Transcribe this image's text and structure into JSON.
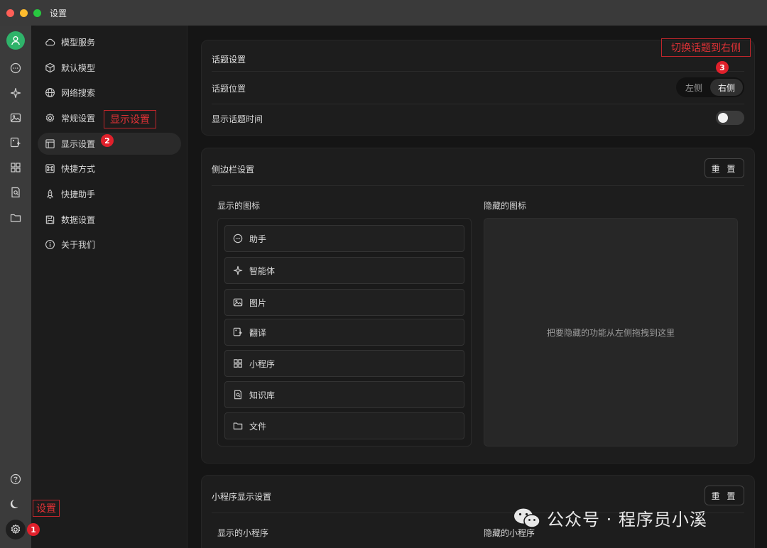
{
  "window": {
    "title": "设置"
  },
  "icon_rail": {
    "items": [
      {
        "icon": "chat-bubble-icon"
      },
      {
        "icon": "sparkle-icon"
      },
      {
        "icon": "image-icon"
      },
      {
        "icon": "translate-icon"
      },
      {
        "icon": "grid-icon"
      },
      {
        "icon": "knowledge-doc-icon"
      },
      {
        "icon": "folder-icon"
      }
    ],
    "bottom": [
      {
        "icon": "help-circle-icon"
      },
      {
        "icon": "moon-icon"
      },
      {
        "icon": "gear-icon"
      }
    ]
  },
  "nav": {
    "items": [
      {
        "label": "模型服务",
        "icon": "cloud-icon"
      },
      {
        "label": "默认模型",
        "icon": "cube-icon"
      },
      {
        "label": "网络搜索",
        "icon": "globe-icon"
      },
      {
        "label": "常规设置",
        "icon": "gear-icon"
      },
      {
        "label": "显示设置",
        "icon": "layout-icon",
        "active": true
      },
      {
        "label": "快捷方式",
        "icon": "command-icon"
      },
      {
        "label": "快捷助手",
        "icon": "rocket-icon"
      },
      {
        "label": "数据设置",
        "icon": "save-icon"
      },
      {
        "label": "关于我们",
        "icon": "info-icon"
      }
    ]
  },
  "topic_card": {
    "title": "话题设置",
    "position_label": "话题位置",
    "position_options": [
      "左侧",
      "右侧"
    ],
    "position_selected": "右侧",
    "show_time_label": "显示话题时间",
    "show_time_enabled": false
  },
  "sidebar_card": {
    "title": "侧边栏设置",
    "reset_label": "重 置",
    "shown_title": "显示的图标",
    "hidden_title": "隐藏的图标",
    "shown_items": [
      {
        "label": "助手",
        "icon": "chat-bubble-icon"
      },
      {
        "label": "智能体",
        "icon": "sparkle-icon"
      },
      {
        "label": "图片",
        "icon": "image-icon"
      },
      {
        "label": "翻译",
        "icon": "translate-icon"
      },
      {
        "label": "小程序",
        "icon": "grid-icon"
      },
      {
        "label": "知识库",
        "icon": "knowledge-doc-icon"
      },
      {
        "label": "文件",
        "icon": "folder-icon"
      }
    ],
    "hidden_placeholder": "把要隐藏的功能从左侧拖拽到这里"
  },
  "miniapp_card": {
    "title": "小程序显示设置",
    "reset_label": "重 置",
    "shown_title": "显示的小程序",
    "hidden_title": "隐藏的小程序"
  },
  "annotations": {
    "a1": {
      "text": "设置",
      "num": "1"
    },
    "a2": {
      "text": "显示设置",
      "num": "2"
    },
    "a3": {
      "text": "切换话题到右侧",
      "num": "3"
    },
    "color": "#e0202b"
  },
  "watermark": {
    "text": "公众号 · 程序员小溪"
  },
  "colors": {
    "avatar": "#2fb36a",
    "active_bg": "#2a2a2a"
  }
}
